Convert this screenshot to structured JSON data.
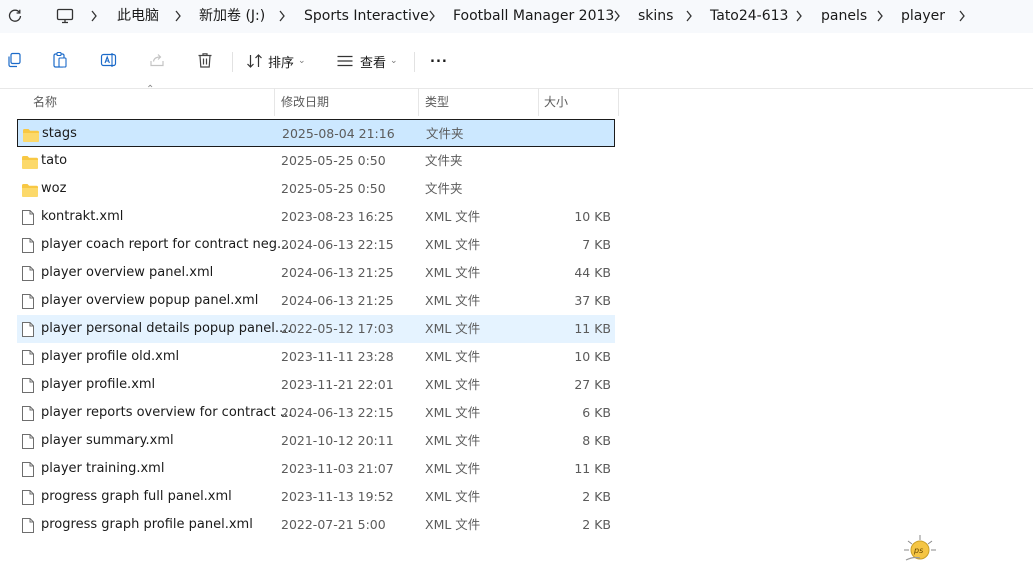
{
  "address": {
    "crumbs": [
      "此电脑",
      "新加卷 (J:)",
      "Sports Interactive",
      "Football Manager 2013",
      "skins",
      "Tato24-613",
      "panels",
      "player"
    ]
  },
  "toolbar": {
    "sort_label": "排序",
    "view_label": "查看",
    "more_label": "..."
  },
  "columns": {
    "name": "名称",
    "date": "修改日期",
    "type": "类型",
    "size": "大小"
  },
  "files": [
    {
      "name": "stags",
      "date": "2025-08-04 21:16",
      "type": "文件夹",
      "size": "",
      "kind": "folder",
      "state": "selected"
    },
    {
      "name": "tato",
      "date": "2025-05-25 0:50",
      "type": "文件夹",
      "size": "",
      "kind": "folder",
      "state": ""
    },
    {
      "name": "woz",
      "date": "2025-05-25 0:50",
      "type": "文件夹",
      "size": "",
      "kind": "folder",
      "state": ""
    },
    {
      "name": "kontrakt.xml",
      "date": "2023-08-23 16:25",
      "type": "XML 文件",
      "size": "10 KB",
      "kind": "file",
      "state": ""
    },
    {
      "name": "player coach report for contract neg...",
      "date": "2024-06-13 22:15",
      "type": "XML 文件",
      "size": "7 KB",
      "kind": "file",
      "state": ""
    },
    {
      "name": "player overview panel.xml",
      "date": "2024-06-13 21:25",
      "type": "XML 文件",
      "size": "44 KB",
      "kind": "file",
      "state": ""
    },
    {
      "name": "player overview popup panel.xml",
      "date": "2024-06-13 21:25",
      "type": "XML 文件",
      "size": "37 KB",
      "kind": "file",
      "state": ""
    },
    {
      "name": "player personal details popup panel....",
      "date": "2022-05-12 17:03",
      "type": "XML 文件",
      "size": "11 KB",
      "kind": "file",
      "state": "hover"
    },
    {
      "name": "player profile old.xml",
      "date": "2023-11-11 23:28",
      "type": "XML 文件",
      "size": "10 KB",
      "kind": "file",
      "state": ""
    },
    {
      "name": "player profile.xml",
      "date": "2023-11-21 22:01",
      "type": "XML 文件",
      "size": "27 KB",
      "kind": "file",
      "state": ""
    },
    {
      "name": "player reports overview for contract ...",
      "date": "2024-06-13 22:15",
      "type": "XML 文件",
      "size": "6 KB",
      "kind": "file",
      "state": ""
    },
    {
      "name": "player summary.xml",
      "date": "2021-10-12 20:11",
      "type": "XML 文件",
      "size": "8 KB",
      "kind": "file",
      "state": ""
    },
    {
      "name": "player training.xml",
      "date": "2023-11-03 21:07",
      "type": "XML 文件",
      "size": "11 KB",
      "kind": "file",
      "state": ""
    },
    {
      "name": "progress graph full panel.xml",
      "date": "2023-11-13 19:52",
      "type": "XML 文件",
      "size": "2 KB",
      "kind": "file",
      "state": ""
    },
    {
      "name": "progress graph profile panel.xml",
      "date": "2022-07-21 5:00",
      "type": "XML 文件",
      "size": "2 KB",
      "kind": "file",
      "state": ""
    }
  ],
  "watermark": {
    "text": "ps"
  },
  "colors": {
    "selected_bg": "#cce8ff",
    "hover_bg": "#e5f3ff",
    "folder": "#f8c844"
  }
}
